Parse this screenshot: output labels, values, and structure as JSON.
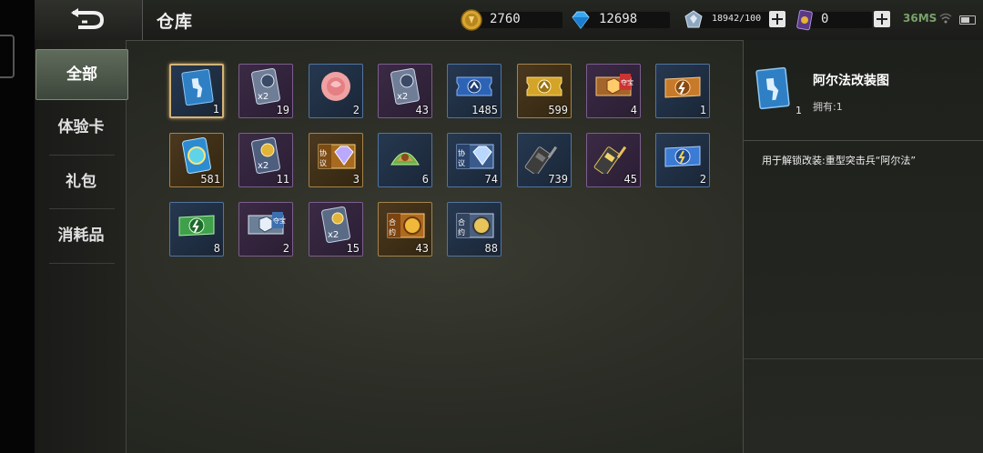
{
  "title": "仓库",
  "resources": [
    {
      "icon": "gold-coin-icon",
      "value": "2760"
    },
    {
      "icon": "blue-diamond-icon",
      "value": "12698"
    },
    {
      "icon": "crystal-icon",
      "value": "18942/100"
    },
    {
      "icon": "purple-card-icon",
      "value": "0"
    }
  ],
  "status": {
    "ping": "36MS"
  },
  "sidebar": {
    "tabs": [
      "全部",
      "体验卡",
      "礼包",
      "消耗品"
    ],
    "active": 0
  },
  "items": [
    {
      "icon": "soldier-blueprint-icon",
      "qty": "1",
      "rarity": "blue",
      "selected": true
    },
    {
      "icon": "double-exp-card-icon",
      "qty": "19",
      "rarity": "purple"
    },
    {
      "icon": "rose-icon",
      "qty": "2",
      "rarity": "blue"
    },
    {
      "icon": "double-exp-card-icon",
      "qty": "43",
      "rarity": "purple"
    },
    {
      "icon": "blue-ticket-icon",
      "qty": "1485",
      "rarity": "blue"
    },
    {
      "icon": "gold-ticket-icon",
      "qty": "599",
      "rarity": "gold"
    },
    {
      "icon": "treasure-ticket-icon",
      "qty": "4",
      "rarity": "purple"
    },
    {
      "icon": "orange-lightning-card-icon",
      "qty": "1",
      "rarity": "blue"
    },
    {
      "icon": "globe-card-icon",
      "qty": "581",
      "rarity": "gold"
    },
    {
      "icon": "gold-double-card-icon",
      "qty": "11",
      "rarity": "purple"
    },
    {
      "icon": "agreement-diamond-icon",
      "qty": "3",
      "rarity": "gold"
    },
    {
      "icon": "zongzi-icon",
      "qty": "6",
      "rarity": "blue"
    },
    {
      "icon": "agreement-diamond-blue-icon",
      "qty": "74",
      "rarity": "blue"
    },
    {
      "icon": "walkie-talkie-icon",
      "qty": "739",
      "rarity": "blue"
    },
    {
      "icon": "gold-walkie-talkie-icon",
      "qty": "45",
      "rarity": "purple"
    },
    {
      "icon": "blue-lightning-card-icon",
      "qty": "2",
      "rarity": "blue"
    },
    {
      "icon": "green-lightning-card-icon",
      "qty": "8",
      "rarity": "blue"
    },
    {
      "icon": "silver-treasure-ticket-icon",
      "qty": "2",
      "rarity": "purple"
    },
    {
      "icon": "double-coin-card-icon",
      "qty": "15",
      "rarity": "purple"
    },
    {
      "icon": "contract-gold-icon",
      "qty": "43",
      "rarity": "gold"
    },
    {
      "icon": "contract-silver-icon",
      "qty": "88",
      "rarity": "blue"
    }
  ],
  "item_badges": {
    "x2": "x2",
    "treasure": "夺宝",
    "agreement": "协议",
    "contract": "合约"
  },
  "detail": {
    "icon": "soldier-blueprint-icon",
    "qty": "1",
    "name": "阿尔法改装图",
    "owned": "拥有:1",
    "description": "用于解锁改装:重型突击兵“阿尔法”"
  }
}
